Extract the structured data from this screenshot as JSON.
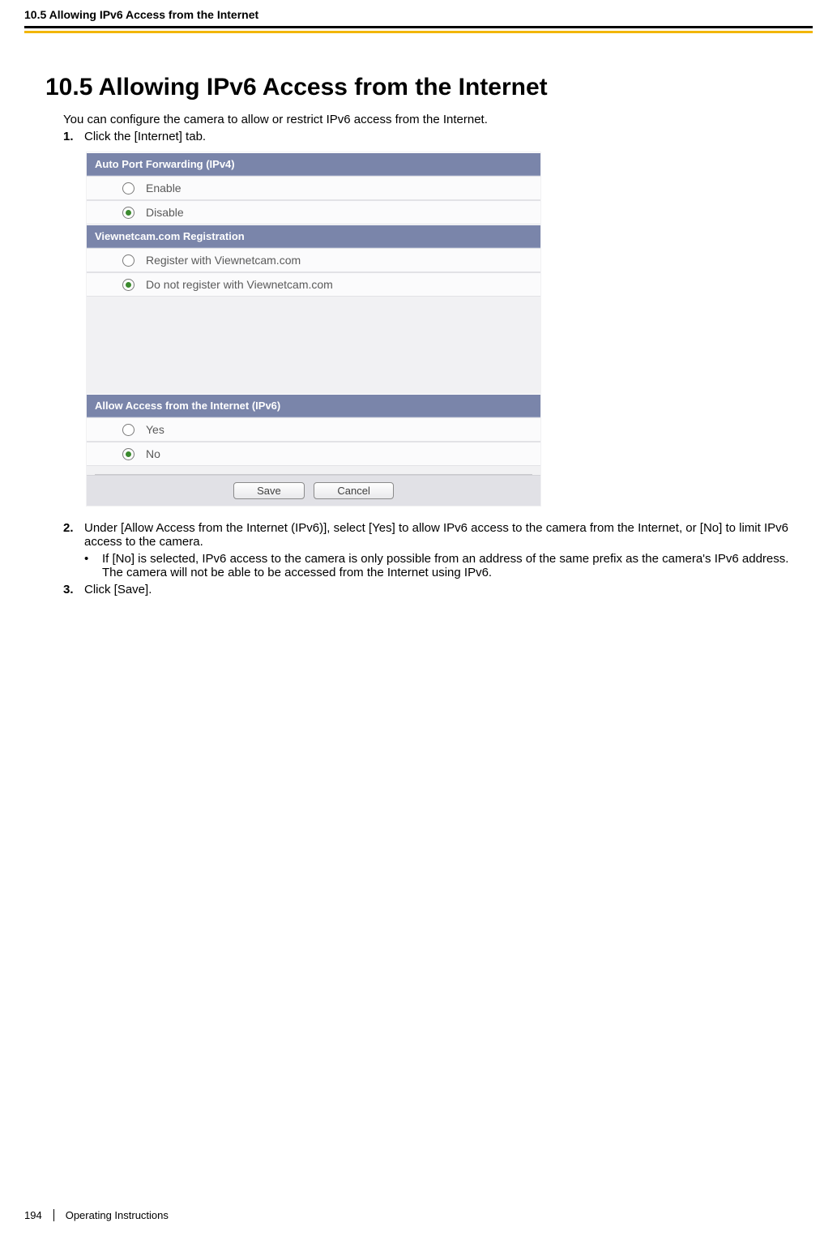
{
  "header": {
    "running_title": "10.5 Allowing IPv6 Access from the Internet"
  },
  "section": {
    "title": "10.5  Allowing IPv6 Access from the Internet",
    "intro": "You can configure the camera to allow or restrict IPv6 access from the Internet.",
    "steps": {
      "s1": {
        "num": "1.",
        "text": "Click the [Internet] tab."
      },
      "s2": {
        "num": "2.",
        "text": "Under [Allow Access from the Internet (IPv6)], select [Yes] to allow IPv6 access to the camera from the Internet, or [No] to limit IPv6 access to the camera.",
        "bullet": "If [No] is selected, IPv6 access to the camera is only possible from an address of the same prefix as the camera's IPv6 address. The camera will not be able to be accessed from the Internet using IPv6."
      },
      "s3": {
        "num": "3.",
        "text": "Click [Save]."
      }
    }
  },
  "ui": {
    "group_autoport": {
      "title": "Auto Port Forwarding (IPv4)",
      "opt_enable": "Enable",
      "opt_disable": "Disable",
      "selected": "disable"
    },
    "group_viewnetcam": {
      "title": "Viewnetcam.com Registration",
      "opt_register": "Register with Viewnetcam.com",
      "opt_noregister": "Do not register with Viewnetcam.com",
      "selected": "noregister"
    },
    "group_ipv6access": {
      "title": "Allow Access from the Internet (IPv6)",
      "opt_yes": "Yes",
      "opt_no": "No",
      "selected": "no"
    },
    "buttons": {
      "save": "Save",
      "cancel": "Cancel"
    }
  },
  "footer": {
    "page_number": "194",
    "doc_title": "Operating Instructions"
  }
}
